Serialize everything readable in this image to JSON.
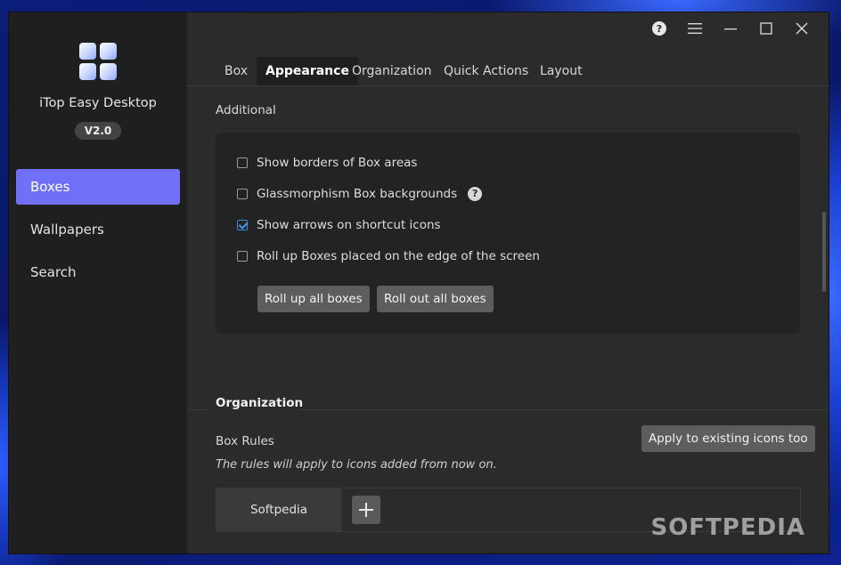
{
  "app": {
    "name": "iTop Easy Desktop",
    "version": "V2.0"
  },
  "sidebar": {
    "items": [
      {
        "label": "Boxes",
        "active": true
      },
      {
        "label": "Wallpapers",
        "active": false
      },
      {
        "label": "Search",
        "active": false
      }
    ]
  },
  "titlebar": {
    "icons": [
      "help-icon",
      "menu-icon",
      "minimize-icon",
      "maximize-icon",
      "close-icon"
    ]
  },
  "tabs": [
    {
      "label": "Box",
      "active": false
    },
    {
      "label": "Appearance",
      "active": true
    },
    {
      "label": "Organization",
      "active": false
    },
    {
      "label": "Quick Actions",
      "active": false
    },
    {
      "label": "Layout",
      "active": false
    }
  ],
  "additional": {
    "heading": "Additional",
    "options": [
      {
        "label": "Show borders of Box areas",
        "checked": false
      },
      {
        "label": "Glassmorphism Box backgrounds",
        "checked": false,
        "help": "?"
      },
      {
        "label": "Show arrows on shortcut icons",
        "checked": true
      },
      {
        "label": "Roll up Boxes placed on the edge of the screen",
        "checked": false
      }
    ],
    "roll_up_button": "Roll up all boxes",
    "roll_out_button": "Roll out all boxes"
  },
  "organization": {
    "title": "Organization",
    "box_rules_label": "Box Rules",
    "apply_button": "Apply to existing icons too",
    "note": "The rules will apply to icons added from now on.",
    "rules": [
      "Softpedia"
    ]
  },
  "watermark": "SOFTPEDIA",
  "colors": {
    "accent": "#6f6ff7",
    "checkbox_checked": "#4a9af0",
    "window_bg": "#2b2b2b",
    "sidebar_bg": "#1f1f1f"
  }
}
